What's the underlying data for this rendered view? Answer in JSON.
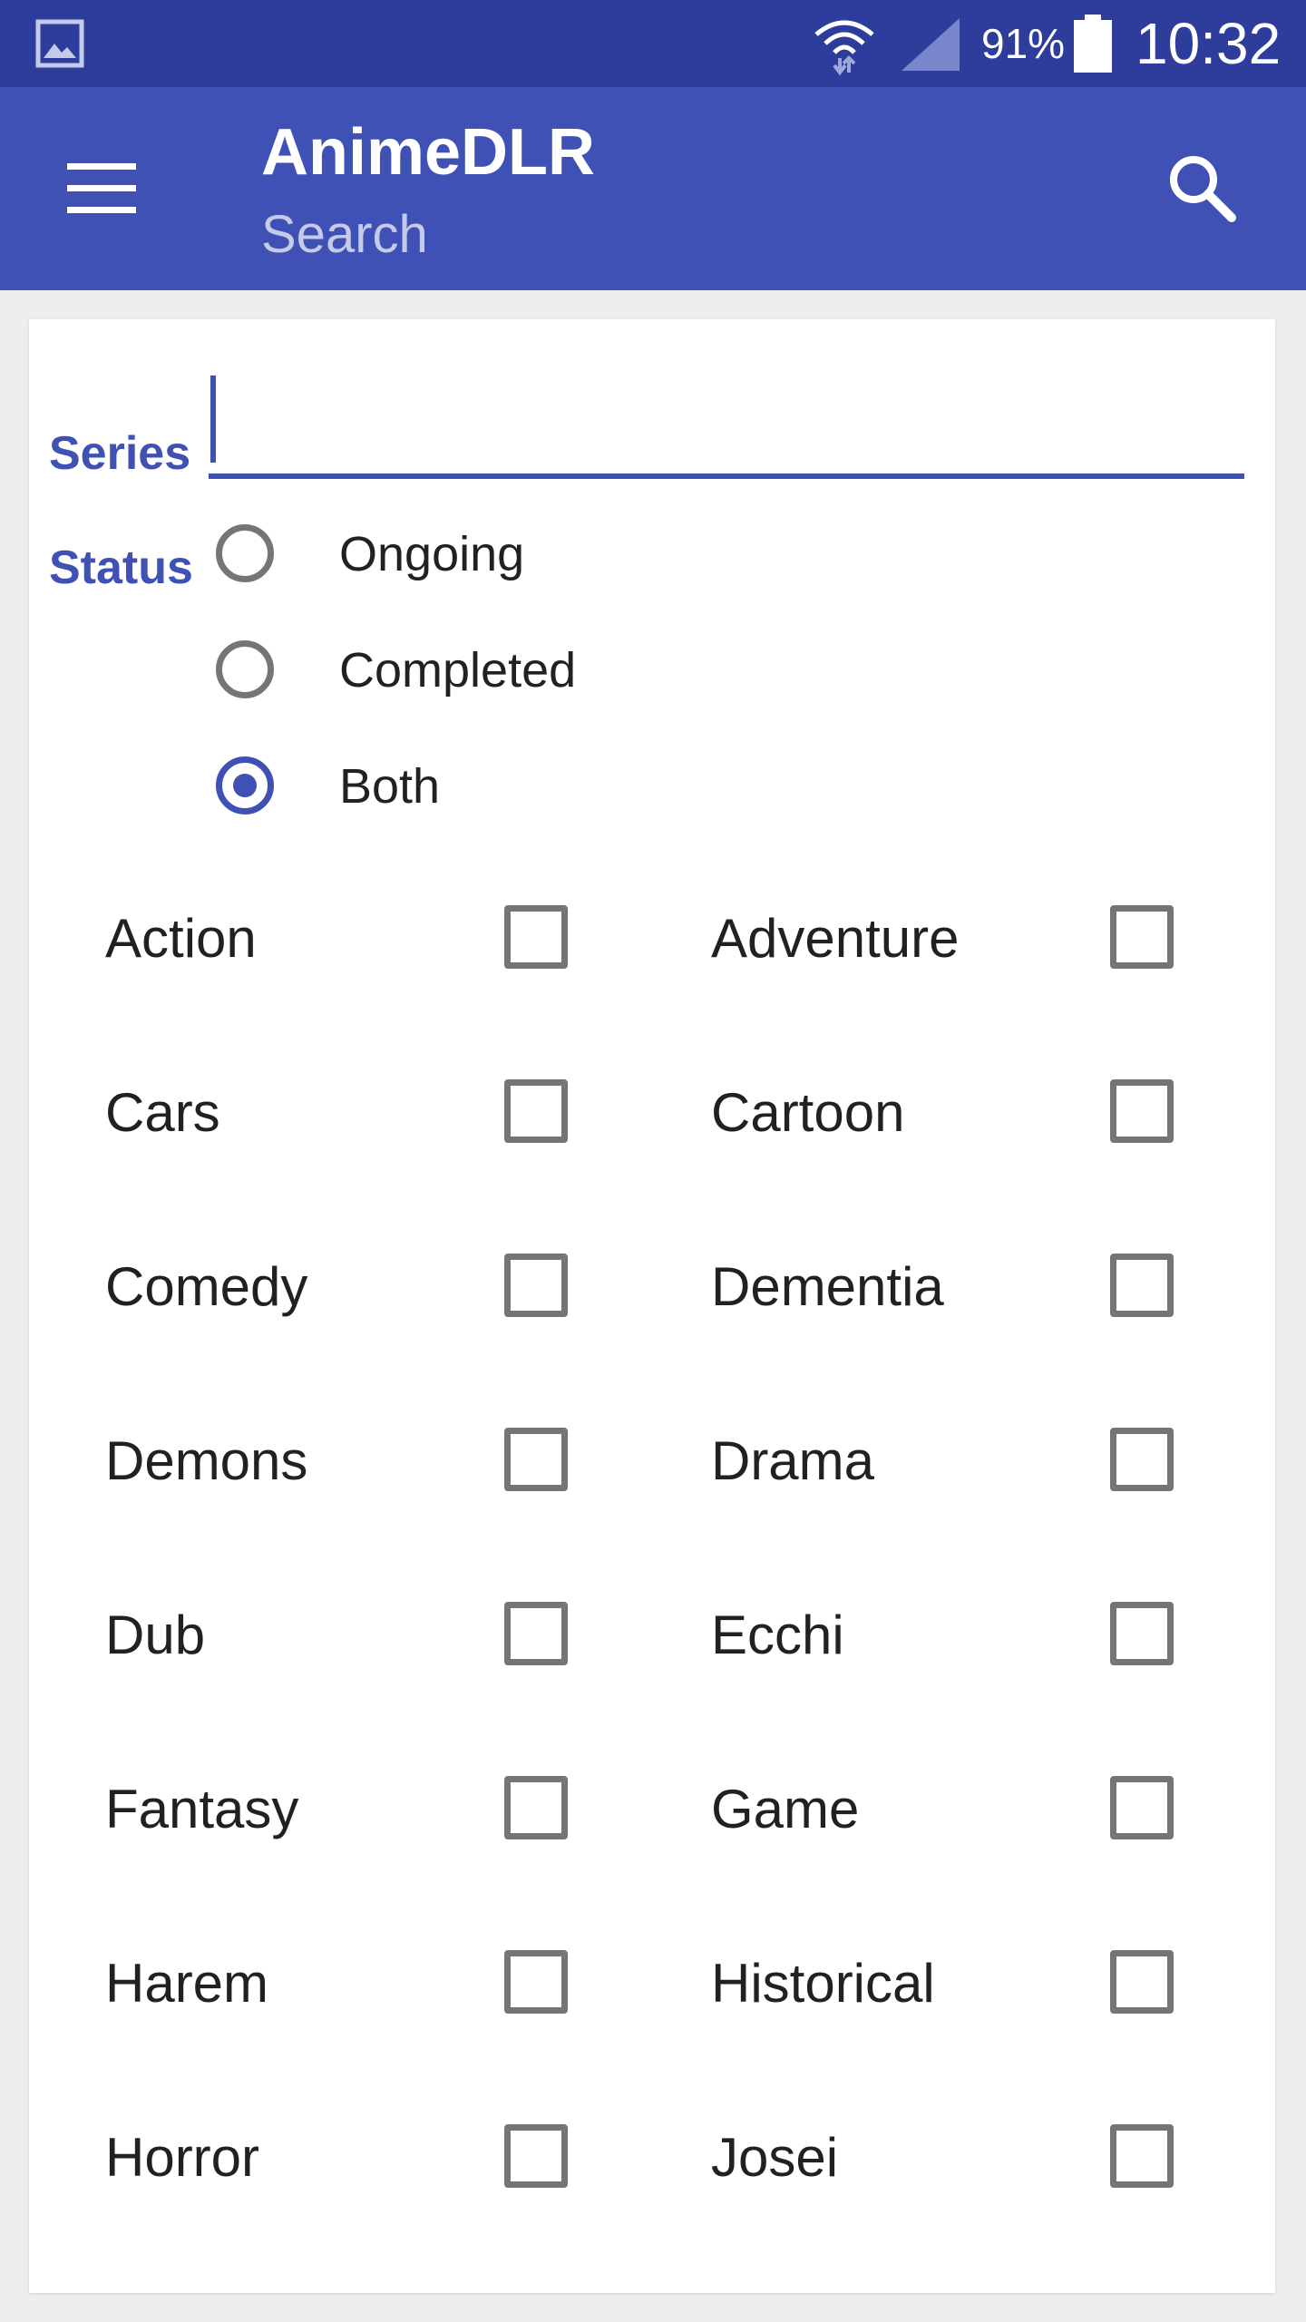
{
  "status_bar": {
    "battery_percent": "91%",
    "time": "10:32",
    "icons": [
      "gallery-icon",
      "wifi-icon",
      "signal-icon",
      "battery-icon"
    ]
  },
  "app_bar": {
    "title": "AnimeDLR",
    "subtitle": "Search",
    "icons": [
      "menu-icon",
      "search-icon"
    ],
    "color": "#3f51b5"
  },
  "form": {
    "series_label": "Series",
    "series_value": "",
    "status_label": "Status",
    "status_options": [
      {
        "label": "Ongoing",
        "checked": false
      },
      {
        "label": "Completed",
        "checked": false
      },
      {
        "label": "Both",
        "checked": true
      }
    ],
    "genres": [
      {
        "label": "Action",
        "checked": false
      },
      {
        "label": "Adventure",
        "checked": false
      },
      {
        "label": "Cars",
        "checked": false
      },
      {
        "label": "Cartoon",
        "checked": false
      },
      {
        "label": "Comedy",
        "checked": false
      },
      {
        "label": "Dementia",
        "checked": false
      },
      {
        "label": "Demons",
        "checked": false
      },
      {
        "label": "Drama",
        "checked": false
      },
      {
        "label": "Dub",
        "checked": false
      },
      {
        "label": "Ecchi",
        "checked": false
      },
      {
        "label": "Fantasy",
        "checked": false
      },
      {
        "label": "Game",
        "checked": false
      },
      {
        "label": "Harem",
        "checked": false
      },
      {
        "label": "Historical",
        "checked": false
      },
      {
        "label": "Horror",
        "checked": false
      },
      {
        "label": "Josei",
        "checked": false
      }
    ]
  }
}
